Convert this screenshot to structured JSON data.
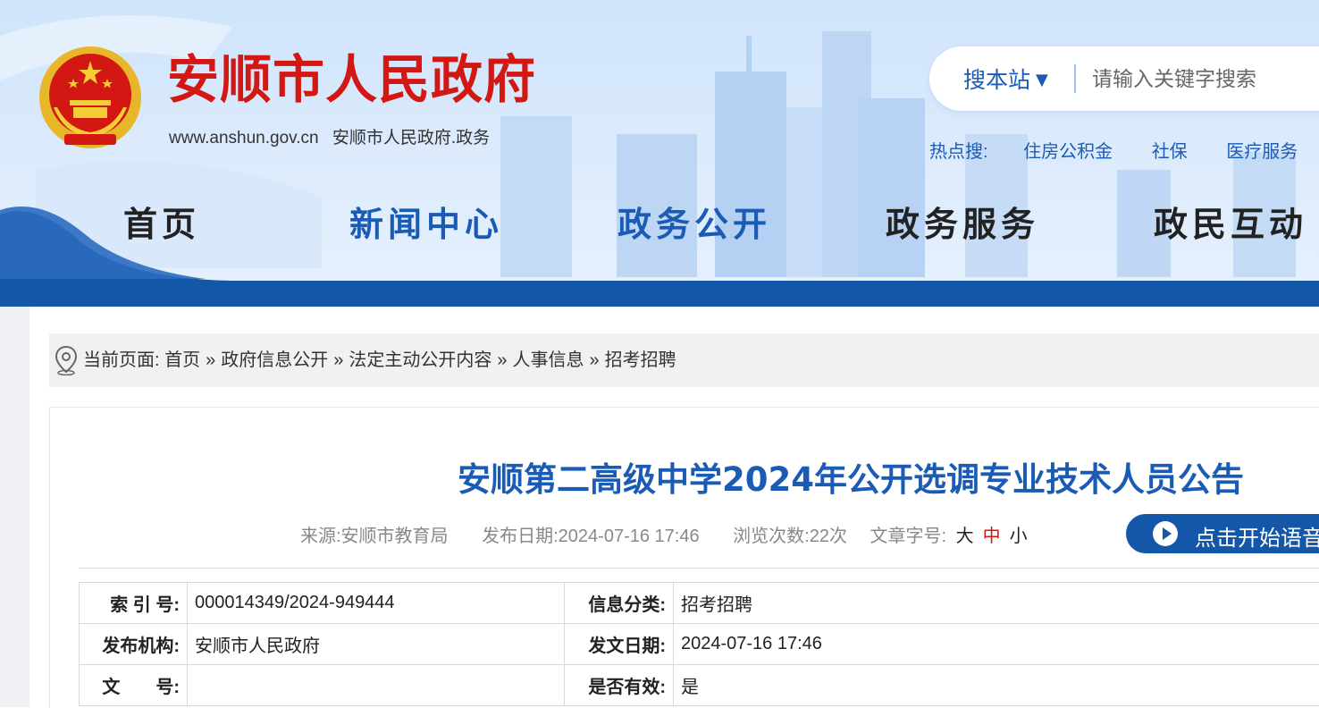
{
  "header": {
    "site_title": "安顺市人民政府",
    "site_url": "www.anshun.gov.cn",
    "site_subtitle": "安顺市人民政府.政务",
    "search": {
      "scope_label": "搜本站",
      "placeholder": "请输入关键字搜索"
    },
    "hot": {
      "label": "热点搜:",
      "items": [
        "住房公积金",
        "社保",
        "医疗服务"
      ]
    }
  },
  "nav": {
    "items": [
      "首页",
      "新闻中心",
      "政务公开",
      "政务服务",
      "政民互动"
    ],
    "colors": [
      "#222222",
      "#1a5bb5",
      "#1a5bb5",
      "#222222",
      "#222222"
    ]
  },
  "breadcrumb": {
    "label": "当前页面:",
    "items": [
      "首页",
      "政府信息公开",
      "法定主动公开内容",
      "人事信息",
      "招考招聘"
    ],
    "separator": "»"
  },
  "article": {
    "title": "安顺第二高级中学2024年公开选调专业技术人员公告",
    "meta": {
      "source": "来源:安顺市教育局",
      "date": "发布日期:2024-07-16 17:46",
      "views": "浏览次数:22次",
      "font_size_label": "文章字号:",
      "size_large": "大",
      "size_medium": "中",
      "size_small": "小"
    },
    "voice_button": "点击开始语音",
    "info_table": {
      "index_label": "索 引 号:",
      "index_value": "000014349/2024-949444",
      "category_label": "信息分类:",
      "category_value": "招考招聘",
      "publisher_label": "发布机构:",
      "publisher_value": "安顺市人民政府",
      "issue_date_label": "发文日期:",
      "issue_date_value": "2024-07-16 17:46",
      "doc_no_label": "文　　号:",
      "doc_no_value": "",
      "valid_label": "是否有效:",
      "valid_value": "是"
    }
  },
  "colors": {
    "brand_red": "#d31712",
    "brand_blue": "#1a5bb5",
    "nav_bar": "#1457a8"
  }
}
